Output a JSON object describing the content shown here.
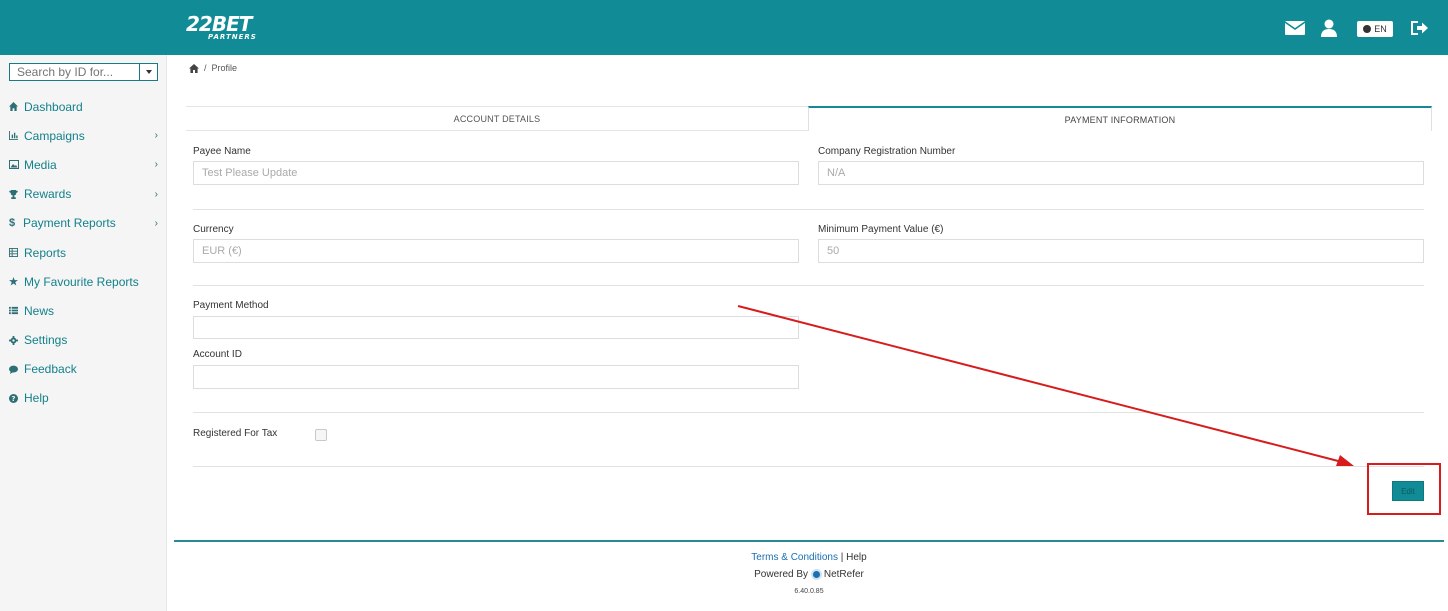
{
  "brand": {
    "logo_main": "22BET",
    "logo_sub": "PARTNERS"
  },
  "header": {
    "language": "EN"
  },
  "sidebar": {
    "search_placeholder": "Search by ID for...",
    "items": [
      {
        "label": "Dashboard",
        "icon": "home-icon",
        "has_submenu": false
      },
      {
        "label": "Campaigns",
        "icon": "bar-chart-icon",
        "has_submenu": true
      },
      {
        "label": "Media",
        "icon": "image-icon",
        "has_submenu": true
      },
      {
        "label": "Rewards",
        "icon": "trophy-icon",
        "has_submenu": true
      },
      {
        "label": "Payment Reports",
        "icon": "dollar-icon",
        "has_submenu": true
      },
      {
        "label": "Reports",
        "icon": "table-icon",
        "has_submenu": false
      },
      {
        "label": "My Favourite Reports",
        "icon": "star-icon",
        "has_submenu": false
      },
      {
        "label": "News",
        "icon": "list-icon",
        "has_submenu": false
      },
      {
        "label": "Settings",
        "icon": "gear-icon",
        "has_submenu": false
      },
      {
        "label": "Feedback",
        "icon": "comment-icon",
        "has_submenu": false
      },
      {
        "label": "Help",
        "icon": "question-icon",
        "has_submenu": false
      }
    ]
  },
  "breadcrumb": {
    "separator": "/",
    "current": "Profile"
  },
  "tabs": [
    {
      "label": "ACCOUNT DETAILS",
      "active": false
    },
    {
      "label": "PAYMENT INFORMATION",
      "active": true
    }
  ],
  "form": {
    "payee_name": {
      "label": "Payee Name",
      "value": "Test Please Update"
    },
    "company_reg": {
      "label": "Company Registration Number",
      "value": "N/A"
    },
    "currency": {
      "label": "Currency",
      "value": "EUR (€)"
    },
    "min_payment": {
      "label": "Minimum Payment Value (€)",
      "value": "50"
    },
    "payment_method": {
      "label": "Payment Method",
      "value": ""
    },
    "account_id": {
      "label": "Account ID",
      "value": ""
    },
    "registered_tax": {
      "label": "Registered For Tax",
      "checked": false
    },
    "edit_label": "Edit"
  },
  "footer": {
    "terms": "Terms & Conditions",
    "divider": "|",
    "help": "Help",
    "powered_by": "Powered By",
    "vendor": "NetRefer",
    "version": "6.40.0.85"
  },
  "colors": {
    "brand": "#118c96",
    "link": "#13818b",
    "annotation": "#d71c1c"
  }
}
